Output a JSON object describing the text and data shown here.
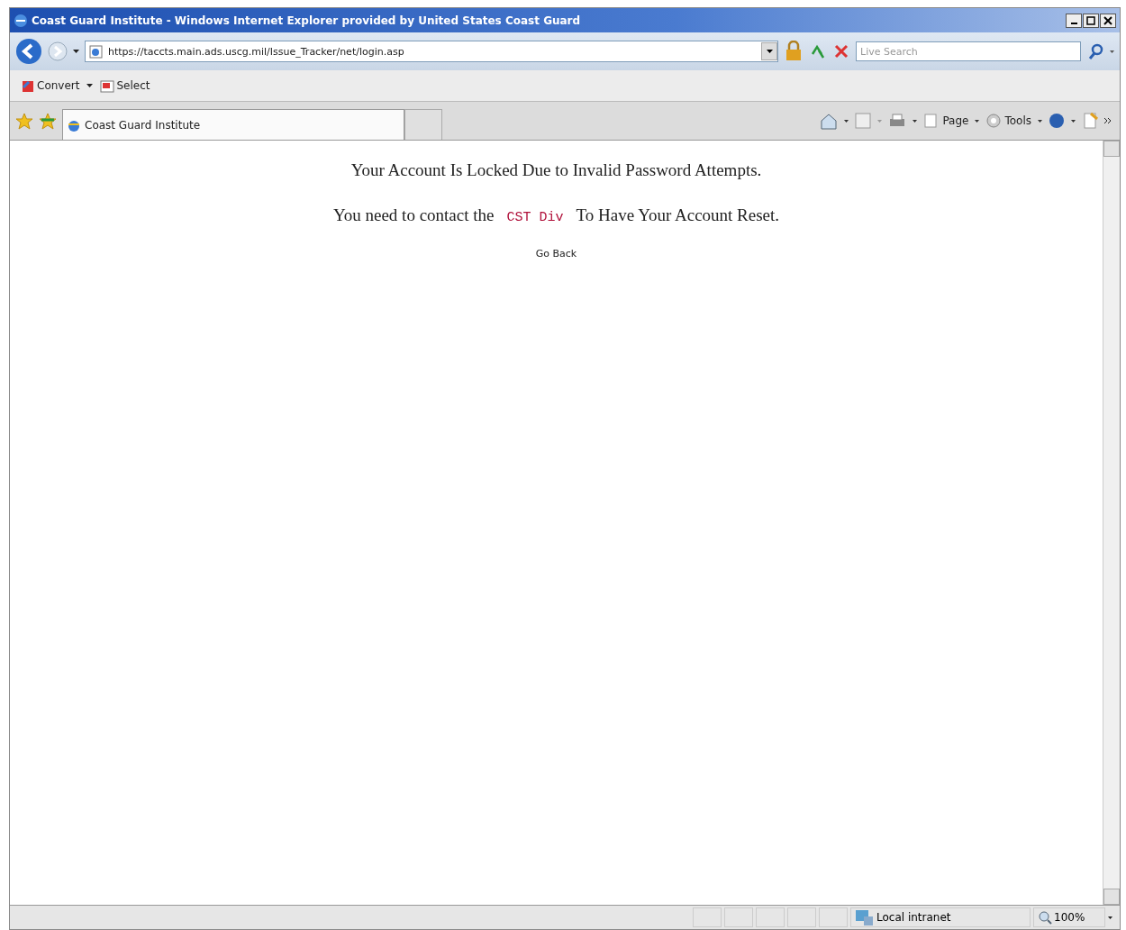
{
  "window": {
    "title": "Coast Guard Institute - Windows Internet Explorer provided by United States Coast Guard"
  },
  "address_bar": {
    "url": "https://taccts.main.ads.uscg.mil/Issue_Tracker/net/login.asp"
  },
  "search": {
    "placeholder": "Live Search"
  },
  "links_bar": [
    {
      "label": "Convert",
      "kind": "convert"
    },
    {
      "label": "Select",
      "kind": "select"
    }
  ],
  "tabs": [
    {
      "label": "Coast Guard Institute",
      "selected": true
    }
  ],
  "command_bar": [
    {
      "label": "Page"
    },
    {
      "label": "Tools"
    }
  ],
  "page": {
    "heading": "Your Account Is Locked Due to Invalid Password Attempts.",
    "contact_before": "You need to contact the",
    "contact_link": "CST Div",
    "contact_after": "To Have Your Account Reset.",
    "back_link": "Go Back"
  },
  "status_bar": {
    "zone": "Local intranet",
    "zoom": "100%"
  }
}
